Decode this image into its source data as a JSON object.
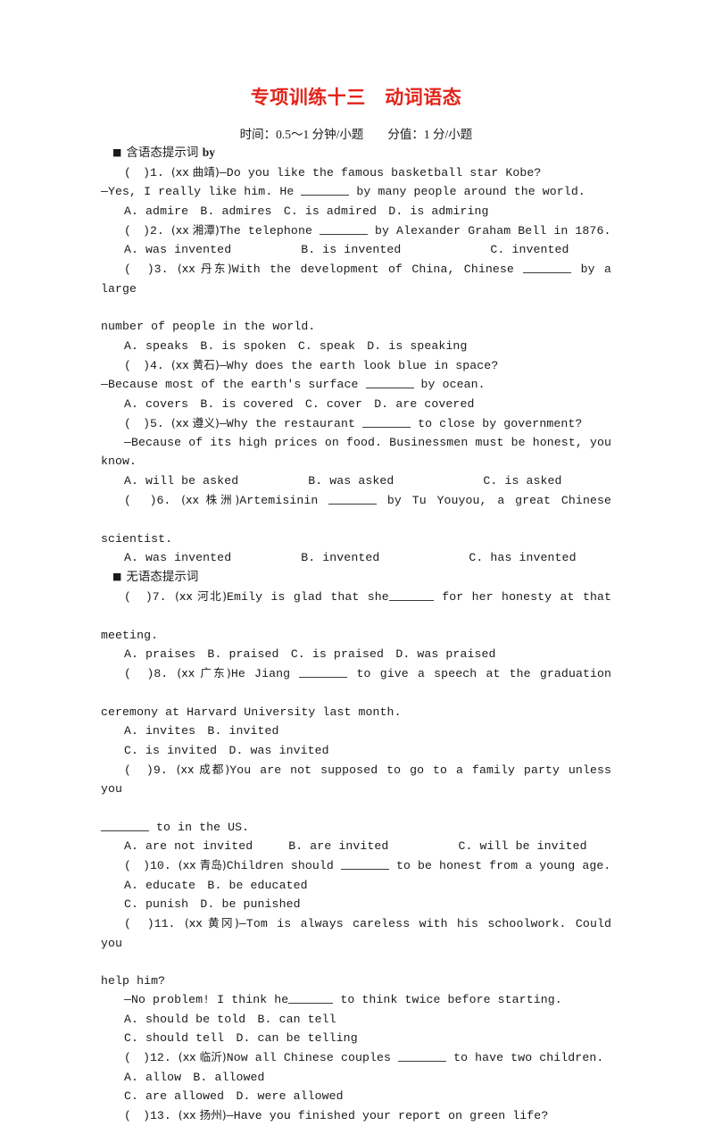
{
  "document": {
    "title": "专项训练十三　动词语态",
    "title_color": "#e2241b",
    "subtitle": "时间：0.5～1 分钟/小题　　分值：1 分/小题"
  },
  "sections": [
    {
      "bullet": "■",
      "label_cn": "含语态提示词",
      "label_en": "by"
    },
    {
      "bullet": "■",
      "label_cn": "无语态提示词",
      "label_en": ""
    }
  ],
  "questions": [
    {
      "marker": "(　)1.",
      "source": "(xx 曲靖)",
      "stem_line1": "—Do you like the famous basketball star Kobe?",
      "stem_line2_pre": "—Yes, I really like him. He ",
      "stem_line2_post": " by many people around the world.",
      "options_line1": "A. admire　B. admires　C. is admired　D. is admiring"
    },
    {
      "marker": "(　)2.",
      "source": "(xx 湘潭)",
      "stem_pre": "The telephone ",
      "stem_post": " by Alexander Graham Bell in 1876.",
      "opt_a": "A. was invented",
      "opt_b": "B. is invented",
      "opt_c": "C. invented"
    },
    {
      "marker": "(　)3.",
      "source": "(xx 丹东)",
      "stem_pre": "With the development of China, Chinese ",
      "stem_post": " by a large",
      "stem_cont": "number of people in the world.",
      "options_line1": "A. speaks　B. is spoken　C. speak　D. is speaking"
    },
    {
      "marker": "(　)4.",
      "source": "(xx 黄石)",
      "stem_line1": "—Why does the earth look blue in space?",
      "stem_line2_pre": "—Because most of the earth's surface ",
      "stem_line2_post": " by ocean.",
      "options_line1": "A. covers　B. is covered　C. cover　D. are covered"
    },
    {
      "marker": "(　)5.",
      "source": "(xx 遵义)",
      "stem_line1_pre": "—Why the restaurant ",
      "stem_line1_post": " to close by government?",
      "stem_line2": "—Because of its high prices on food. Businessmen must be honest, you know.",
      "opt_a": "A. will be asked",
      "opt_b": "B. was asked",
      "opt_c": "C. is asked"
    },
    {
      "marker": "(　)6.",
      "source": "(xx 株洲)",
      "stem_pre": "Artemisinin ",
      "stem_post": " by Tu Youyou, a great Chinese",
      "stem_cont": "scientist.",
      "opt_a": "A. was invented",
      "opt_b": "B. invented",
      "opt_c": "C. has invented"
    },
    {
      "marker": "(　)7.",
      "source": "(xx 河北)",
      "stem_pre": "Emily is glad that she",
      "stem_post": " for her honesty at that",
      "stem_cont": "meeting.",
      "options_line1": "A. praises　B. praised　C. is praised　D. was praised"
    },
    {
      "marker": "(　)8.",
      "source": "(xx 广东)",
      "stem_pre": "He Jiang ",
      "stem_post": " to give a speech at the graduation",
      "stem_cont": "ceremony at Harvard University last month.",
      "options_line1": "A. invites　B. invited",
      "options_line2": "C. is invited　D. was invited"
    },
    {
      "marker": "(　)9.",
      "source": "(xx 成都)",
      "stem_pre": "You are not supposed to go to a family party unless you",
      "stem_cont_post": " to in the US.",
      "opt_a": "A. are not invited",
      "opt_b": "B. are invited",
      "opt_c": "C. will be invited"
    },
    {
      "marker": "(　)10.",
      "source": "(xx 青岛)",
      "stem_pre": "Children should ",
      "stem_post": " to be honest from a young age.",
      "options_line1": "A. educate　B. be educated",
      "options_line2": "C. punish　D. be punished"
    },
    {
      "marker": "(　)11.",
      "source": "(xx 黄冈)",
      "stem_line1": "—Tom is always careless with his schoolwork. Could you",
      "stem_cont": "help him?",
      "stem_line2_pre": "—No problem! I think he",
      "stem_line2_post": " to think twice before starting.",
      "options_line1": "A. should be told　B. can tell",
      "options_line2": "C. should tell　D. can be telling"
    },
    {
      "marker": "(　)12.",
      "source": "(xx 临沂)",
      "stem_pre": "Now all Chinese couples ",
      "stem_post": " to have two children.",
      "options_line1": "A. allow　B. allowed",
      "options_line2": "C. are allowed　D. were allowed"
    },
    {
      "marker": "(　)13.",
      "source": "(xx 扬州)",
      "stem_line1": "—Have you finished your report on green life?"
    }
  ]
}
